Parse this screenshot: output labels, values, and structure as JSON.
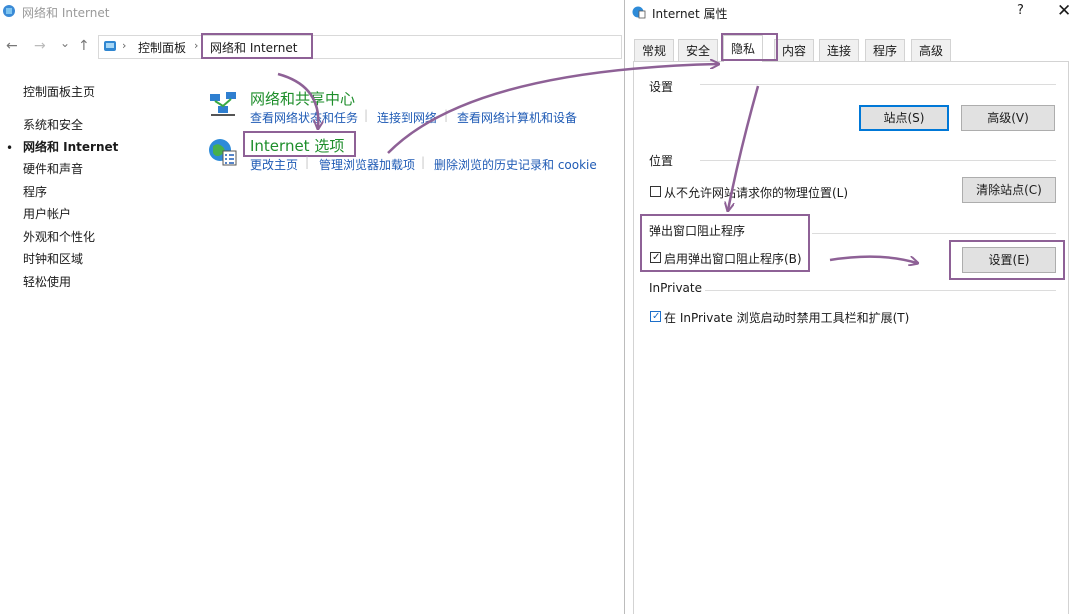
{
  "control_panel": {
    "window_title": "网络和 Internet",
    "nav": {
      "back": "←",
      "forward": "→",
      "recent": "⌄",
      "up": "↑"
    },
    "breadcrumb": [
      "控制面板",
      "网络和 Internet"
    ],
    "sidebar": [
      "控制面板主页",
      "系统和安全",
      "网络和 Internet",
      "硬件和声音",
      "程序",
      "用户帐户",
      "外观和个性化",
      "时钟和区域",
      "轻松使用"
    ],
    "categories": [
      {
        "title": "网络和共享中心",
        "links": [
          "查看网络状态和任务",
          "连接到网络",
          "查看网络计算机和设备"
        ]
      },
      {
        "title": "Internet 选项",
        "links": [
          "更改主页",
          "管理浏览器加载项",
          "删除浏览的历史记录和 cookie"
        ]
      }
    ]
  },
  "dialog": {
    "title": "Internet 属性",
    "help": "?",
    "close": "✕",
    "tabs": [
      "常规",
      "安全",
      "隐私",
      "内容",
      "连接",
      "程序",
      "高级"
    ],
    "active_tab": "隐私",
    "settings_group": {
      "label": "设置",
      "sites_button": "站点(S)",
      "advanced_button": "高级(V)"
    },
    "location_group": {
      "label": "位置",
      "checkbox": "从不允许网站请求你的物理位置(L)",
      "checked": false,
      "clear_button": "清除站点(C)"
    },
    "popup_group": {
      "label": "弹出窗口阻止程序",
      "checkbox": "启用弹出窗口阻止程序(B)",
      "checked": true,
      "settings_button": "设置(E)"
    },
    "inprivate_group": {
      "label": "InPrivate",
      "checkbox": "在 InPrivate 浏览启动时禁用工具栏和扩展(T)",
      "checked": true
    }
  },
  "colors": {
    "highlight": "#8e6196",
    "link": "#1f5bb5",
    "category": "#1e8e2b",
    "focus": "#0078d7"
  }
}
